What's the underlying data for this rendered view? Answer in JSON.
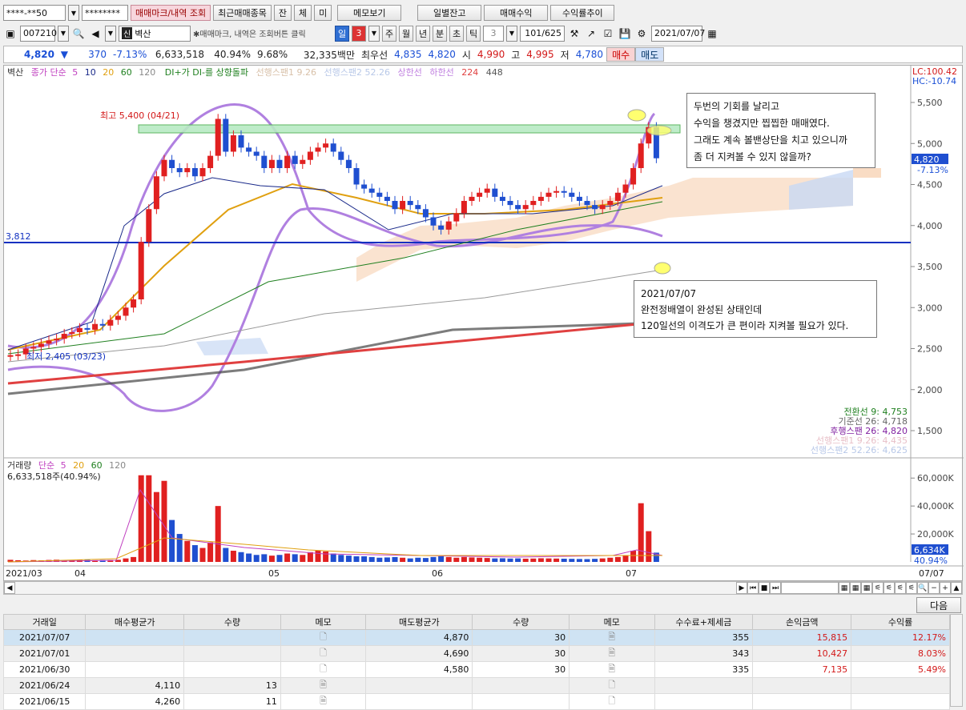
{
  "toolbar1": {
    "account": "****-**50",
    "password": "********",
    "buttons": [
      "매매마크/내역 조회",
      "최근매매종목",
      "잔",
      "체",
      "미",
      "메모보기"
    ],
    "right_buttons": [
      "일별잔고",
      "매매수익",
      "수익률추이"
    ]
  },
  "toolbar2": {
    "code": "007210",
    "name": "벽산",
    "hint": "✱매매마크, 내역은 조회버튼 클릭",
    "period": "일",
    "period_n": "3",
    "periods": [
      "주",
      "월",
      "년",
      "분",
      "초",
      "틱"
    ],
    "tick_n": "3",
    "count": "101/625",
    "date": "2021/07/07"
  },
  "quote": {
    "price": "4,820",
    "arrow": "▼",
    "change": "370",
    "rate": "-7.13%",
    "volume": "6,633,518",
    "vol_ratio": "40.94%",
    "turnover": "9.68%",
    "amount": "32,335백만",
    "best_label": "최우선",
    "best_ask": "4,835",
    "best_bid": "4,820",
    "open_label": "시",
    "open": "4,990",
    "high_label": "고",
    "high": "4,995",
    "low_label": "저",
    "low": "4,780",
    "buy": "매수",
    "sell": "매도"
  },
  "chart": {
    "legend": {
      "name": "벽산",
      "ma": "종가 단순",
      "p5": "5",
      "p10": "10",
      "p20": "20",
      "p60": "60",
      "p120": "120",
      "di": "DI+가 DI-를 상향돌파",
      "ich1": "선행스팬1 9.26",
      "ich2": "선행스팬2 52.26",
      "upper": "상한선",
      "lower": "하한선",
      "n224": "224",
      "n448": "448"
    },
    "lc": "LC:100.42",
    "hc": "HC:-10.74",
    "price_ticks": [
      "5,500",
      "5,000",
      "4,500",
      "4,000",
      "3,500",
      "3,000",
      "2,500",
      "2,000",
      "1,500"
    ],
    "price_tag": "4,820",
    "price_tag_rate": "-7.13%",
    "hline_label": "3,812",
    "high_label": "최고 5,400 (04/21)",
    "low_label": "최저 2,405 (03/23)",
    "note1": [
      "두번의 기회를 날리고",
      "수익을 챙겼지만 찝찝한 매매였다.",
      "그래도 계속 볼밴상단을 치고 있으니까",
      "좀 더 지켜볼 수 있지 않을까?"
    ],
    "note2": [
      "2021/07/07",
      "완전정배열이 완성된 상태인데",
      "120일선의 이격도가 큰 편이라 지켜볼 필요가 있다."
    ],
    "ichimoku": [
      "전환선 9: 4,753",
      "기준선 26: 4,718",
      "후행스팬 26: 4,820",
      "선행스팬1 9.26: 4,435",
      "선행스팬2 52.26: 4,625"
    ],
    "vol_legend": {
      "name": "거래량",
      "ma": "단순",
      "p5": "5",
      "p20": "20",
      "p60": "60",
      "p120": "120"
    },
    "vol_value": "6,633,518주(40.94%)",
    "vol_ticks": [
      "60,000K",
      "40,000K",
      "20,000K"
    ],
    "vol_tag": "6,634K",
    "vol_tag2": "40.94%",
    "dates": [
      "2021/03",
      "04",
      "05",
      "06",
      "07"
    ],
    "date_right": "07/07"
  },
  "table": {
    "next": "다음",
    "headers": [
      "거래일",
      "매수평균가",
      "수량",
      "메모",
      "매도평균가",
      "수량",
      "메모",
      "수수료+제세금",
      "손익금액",
      "수익률"
    ],
    "rows": [
      [
        "2021/07/07",
        "",
        "",
        "",
        "4,870",
        "30",
        "",
        "355",
        "15,815",
        "12.17%"
      ],
      [
        "2021/07/01",
        "",
        "",
        "",
        "4,690",
        "30",
        "",
        "343",
        "10,427",
        "8.03%"
      ],
      [
        "2021/06/30",
        "",
        "",
        "",
        "4,580",
        "30",
        "",
        "335",
        "7,135",
        "5.49%"
      ],
      [
        "2021/06/24",
        "4,110",
        "13",
        "",
        "",
        "",
        "",
        "",
        "",
        ""
      ],
      [
        "2021/06/15",
        "4,260",
        "11",
        "",
        "",
        "",
        "",
        "",
        "",
        ""
      ]
    ]
  },
  "colors": {
    "up": "#e02020",
    "down": "#1f4fd0",
    "ma5": "#c040c0",
    "ma10": "#1a2a8a",
    "ma20": "#e0a010",
    "ma60": "#208020",
    "ma120": "#808080",
    "bb": "#b080e0",
    "hline": "#1030c0"
  }
}
